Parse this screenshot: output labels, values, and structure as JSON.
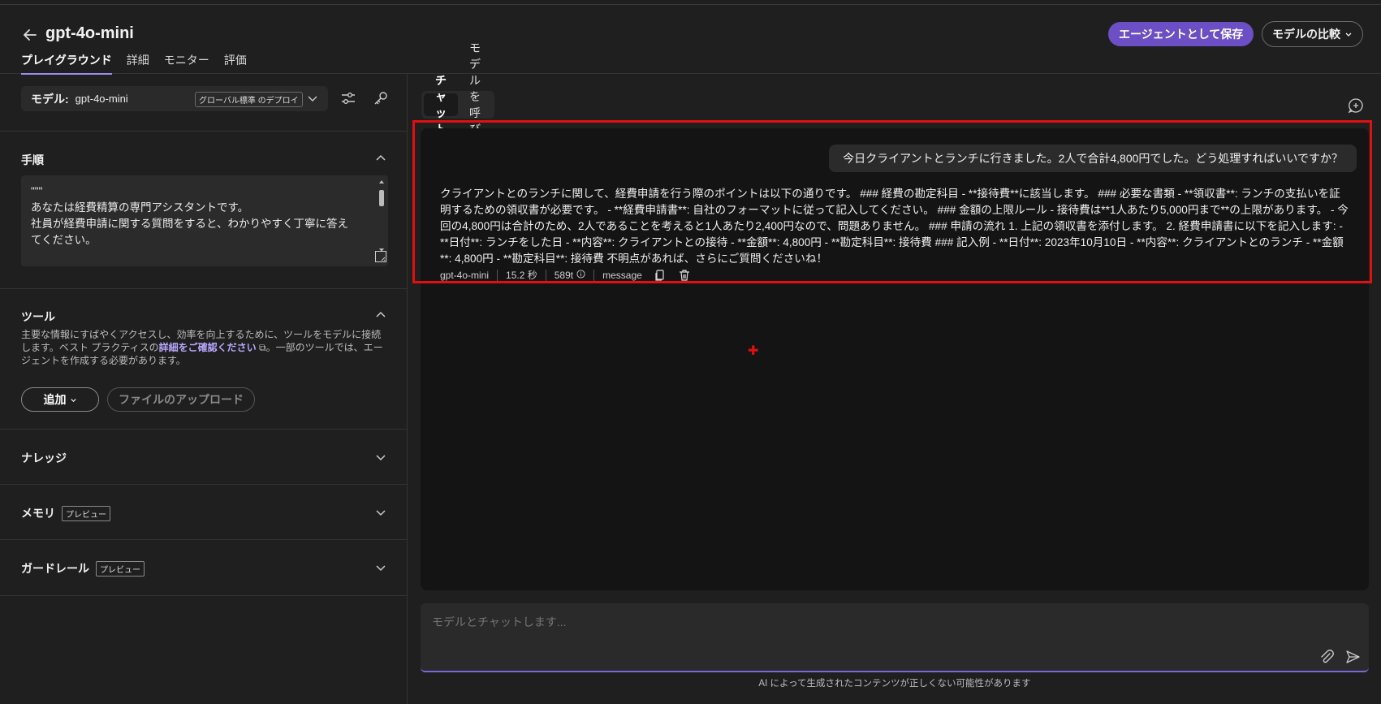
{
  "header": {
    "title": "gpt-4o-mini",
    "tabs": [
      "プレイグラウンド",
      "詳細",
      "モニター",
      "評価"
    ],
    "save_agent": "エージェントとして保存",
    "compare_models": "モデルの比較"
  },
  "left": {
    "model_label": "モデル:",
    "model_value": "gpt-4o-mini",
    "deploy_badge": "グローバル標準 のデプロイ",
    "instructions": {
      "title": "手順",
      "text": "\"\"\"\nあなたは経費精算の専門アシスタントです。\n社員が経費申請に関する質問をすると、わかりやすく丁寧に答えてください。\n\n## あなたの役割"
    },
    "tools": {
      "title": "ツール",
      "desc_before": "主要な情報にすばやくアクセスし、効率を向上するために、ツールをモデルに接続します。ベスト プラクティスの",
      "desc_link": "詳細をご確認ください",
      "desc_after": "。一部のツールでは、エージェントを作成する必要があります。",
      "add_label": "追加",
      "upload_label": "ファイルのアップロード"
    },
    "knowledge": {
      "title": "ナレッジ"
    },
    "memory": {
      "title": "メモリ",
      "badge": "プレビュー"
    },
    "guardrails": {
      "title": "ガードレール",
      "badge": "プレビュー"
    }
  },
  "right": {
    "segments": [
      "チャット",
      "モデルを呼び出す"
    ],
    "user_message": "今日クライアントとランチに行きました。2人で合計4,800円でした。どう処理すればいいですか？",
    "bot_message": "クライアントとのランチに関して、経費申請を行う際のポイントは以下の通りです。 ### 経費の勘定科目 - **接待費**に該当します。 ### 必要な書類 - **領収書**: ランチの支払いを証明するための領収書が必要です。 - **経費申請書**: 自社のフォーマットに従って記入してください。 ### 金額の上限ルール - 接待費は**1人あたり5,000円まで**の上限があります。 - 今回の4,800円は合計のため、2人であることを考えると1人あたり2,400円なので、問題ありません。 ### 申請の流れ 1. 上記の領収書を添付します。 2. 経費申請書に以下を記入します: - **日付**: ランチをした日 - **内容**: クライアントとの接待 - **金額**: 4,800円 - **勘定科目**: 接待費 ### 記入例 - **日付**: 2023年10月10日 - **内容**: クライアントとのランチ - **金額**: 4,800円 - **勘定科目**: 接待費 不明点があれば、さらにご質問くださいね！",
    "meta": {
      "model": "gpt-4o-mini",
      "time": "15.2 秒",
      "tokens": "589t",
      "type": "message"
    },
    "input_placeholder": "モデルとチャットします...",
    "disclaimer": "AI によって生成されたコンテンツが正しくない可能性があります"
  }
}
